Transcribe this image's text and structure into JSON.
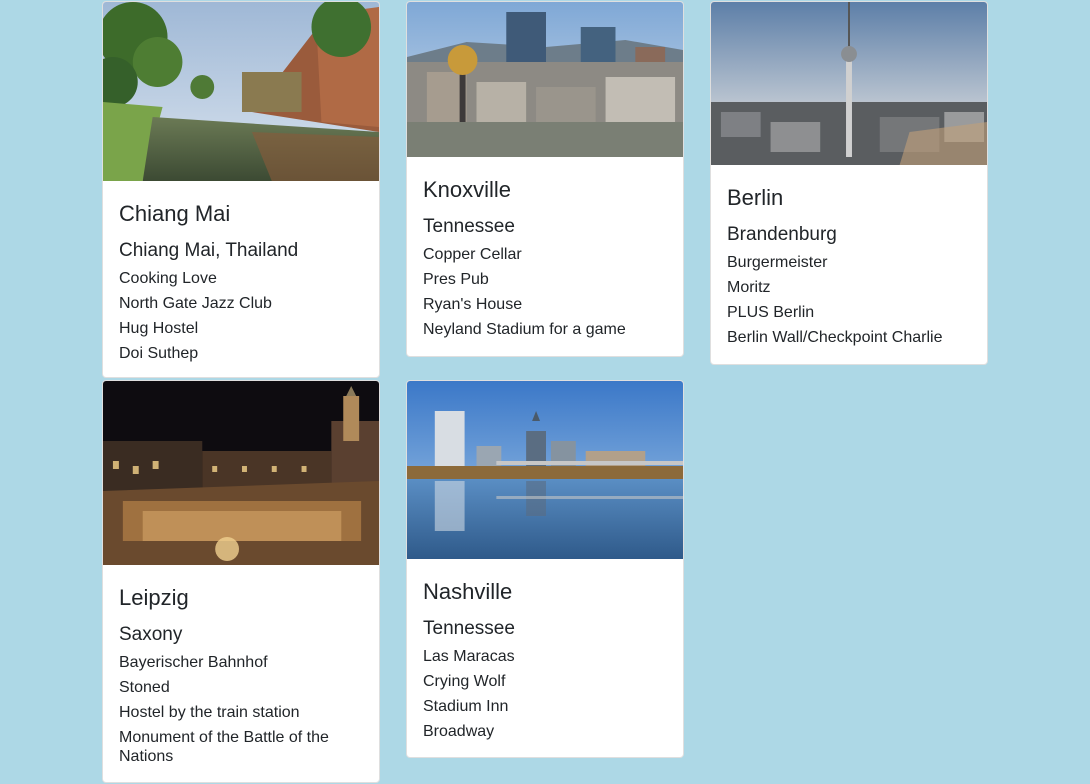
{
  "cards": [
    {
      "title": "Chiang Mai",
      "subtitle": "Chiang Mai, Thailand",
      "places": [
        "Cooking Love",
        "North Gate Jazz Club",
        "Hug Hostel",
        "Doi Suthep"
      ],
      "image": "chiang-mai-moat-photo"
    },
    {
      "title": "Knoxville",
      "subtitle": "Tennessee",
      "places": [
        "Copper Cellar",
        "Pres Pub",
        "Ryan's House",
        "Neyland Stadium for a game"
      ],
      "image": "knoxville-skyline-photo"
    },
    {
      "title": "Berlin",
      "subtitle": "Brandenburg",
      "places": [
        "Burgermeister",
        "Moritz",
        "PLUS Berlin",
        "Berlin Wall/Checkpoint Charlie"
      ],
      "image": "berlin-tv-tower-photo"
    },
    {
      "title": "Leipzig",
      "subtitle": "Saxony",
      "places": [
        "Bayerischer Bahnhof",
        "Stoned",
        "Hostel by the train station",
        "Monument of the Battle of the Nations"
      ],
      "image": "leipzig-christmas-market-photo"
    },
    {
      "title": "Nashville",
      "subtitle": "Tennessee",
      "places": [
        "Las Maracas",
        "Crying Wolf",
        "Stadium Inn",
        "Broadway"
      ],
      "image": "nashville-skyline-photo"
    }
  ],
  "colors": {
    "background": "#add8e6",
    "card": "#ffffff",
    "text": "#212529"
  }
}
